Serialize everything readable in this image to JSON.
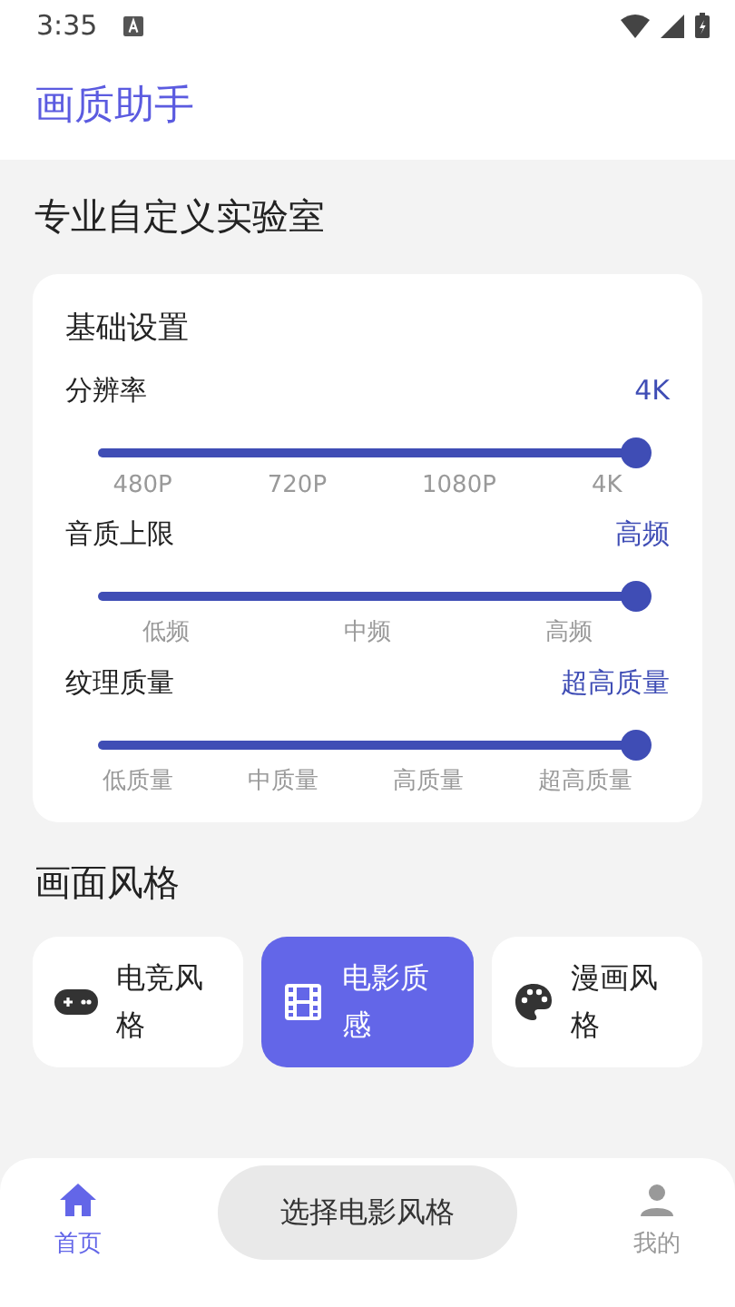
{
  "status_bar": {
    "time": "3:35"
  },
  "app_bar": {
    "title": "画质助手"
  },
  "section_title": "专业自定义实验室",
  "settings_card": {
    "title": "基础设置",
    "sliders": [
      {
        "label": "分辨率",
        "reading": "4K",
        "level": 1,
        "ticks": [
          "480P",
          "720P",
          "1080P",
          "4K"
        ]
      },
      {
        "label": "音质上限",
        "reading": "高频",
        "level": 1,
        "ticks": [
          "低频",
          "中频",
          "高频"
        ]
      },
      {
        "label": "纹理质量",
        "reading": "超高质量",
        "level": 1,
        "ticks": [
          "低质量",
          "中质量",
          "高质量",
          "超高质量"
        ]
      }
    ]
  },
  "style_section": {
    "title": "画面风格",
    "options": [
      {
        "label": "电竞风格",
        "kind": "gamepad",
        "selected": false
      },
      {
        "label": "电影质感",
        "kind": "film",
        "selected": true
      },
      {
        "label": "漫画风格",
        "kind": "palette",
        "selected": false
      }
    ]
  },
  "toast": "选择电影风格",
  "bottom_nav": [
    {
      "label": "首页",
      "kind": "home",
      "selected": true
    },
    {
      "label": "我的",
      "kind": "person",
      "selected": false
    }
  ]
}
